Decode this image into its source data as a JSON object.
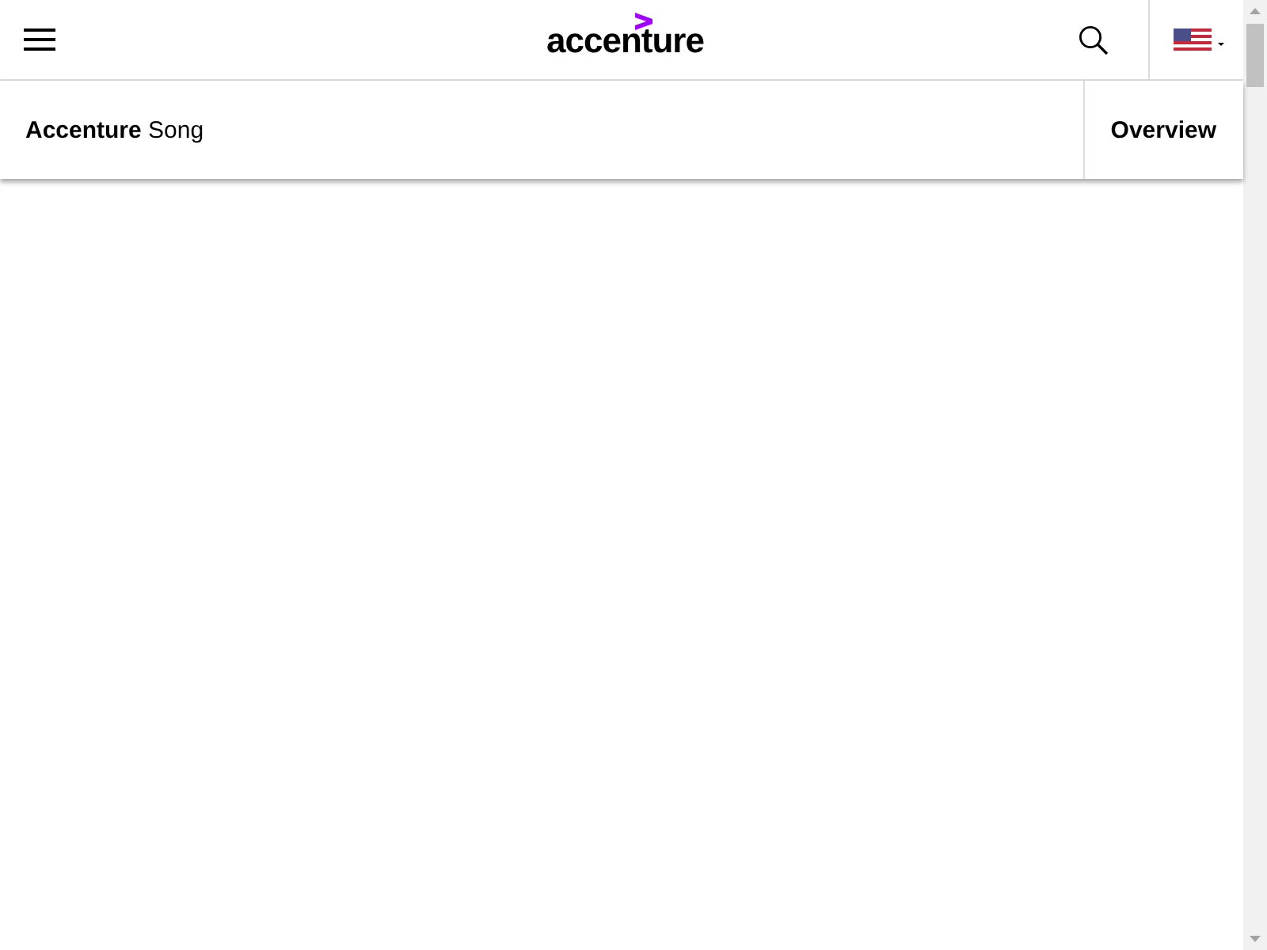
{
  "header": {
    "logo": "accenture"
  },
  "subnav": {
    "title": "**Accenture** Song",
    "link": "Overview"
  }
}
